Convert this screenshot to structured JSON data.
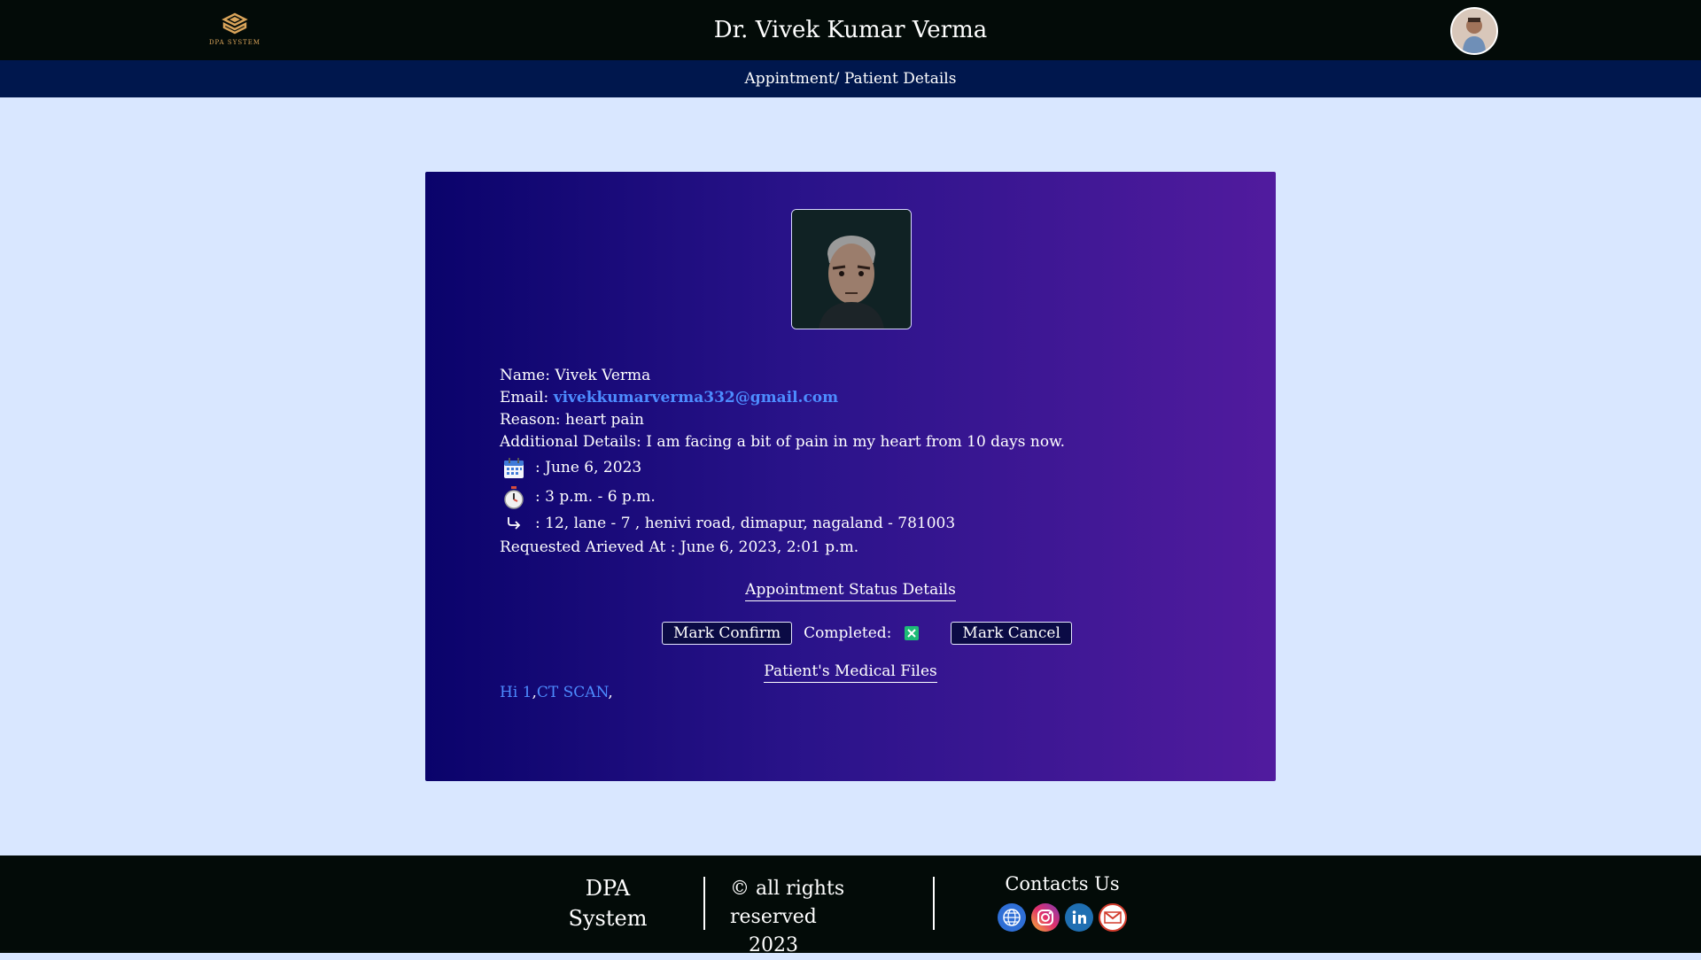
{
  "header": {
    "logo_text": "DPA SYSTEM",
    "doctor_name": "Dr. Vivek Kumar Verma",
    "subtitle": "Appintment/ Patient Details"
  },
  "patient": {
    "name_label": "Name:",
    "name": "Vivek Verma",
    "email_label": "Email:",
    "email": "vivekkumarverma332@gmail.com",
    "reason_label": "Reason:",
    "reason": "heart pain",
    "additional_label": "Additional Details:",
    "additional": "I am facing a bit of pain in my heart from 10 days now.",
    "date": ": June 6, 2023",
    "time": ": 3 p.m. - 6 p.m.",
    "address": ": 12, lane - 7 , henivi road, dimapur, nagaland - 781003",
    "requested_label": "Requested Arieved At :",
    "requested": "June 6, 2023, 2:01 p.m."
  },
  "status": {
    "title": "Appointment Status Details",
    "confirm_label": "Mark Confirm",
    "completed_label": "Completed:",
    "cancel_label": "Mark Cancel"
  },
  "files": {
    "title": "Patient's Medical Files",
    "items": [
      "Hi 1",
      "CT SCAN"
    ]
  },
  "footer": {
    "brand_line1": "DPA",
    "brand_line2": "System",
    "copyright": "© all rights reserved",
    "year": "2023",
    "contacts": "Contacts Us"
  },
  "icons": {
    "date": "calendar-icon",
    "time": "stopwatch-icon",
    "address": "arrow-return-icon"
  },
  "colors": {
    "link": "#4d8cff",
    "topbar": "#030b08",
    "subbar": "#00174d",
    "page_bg": "#d9e7ff"
  }
}
